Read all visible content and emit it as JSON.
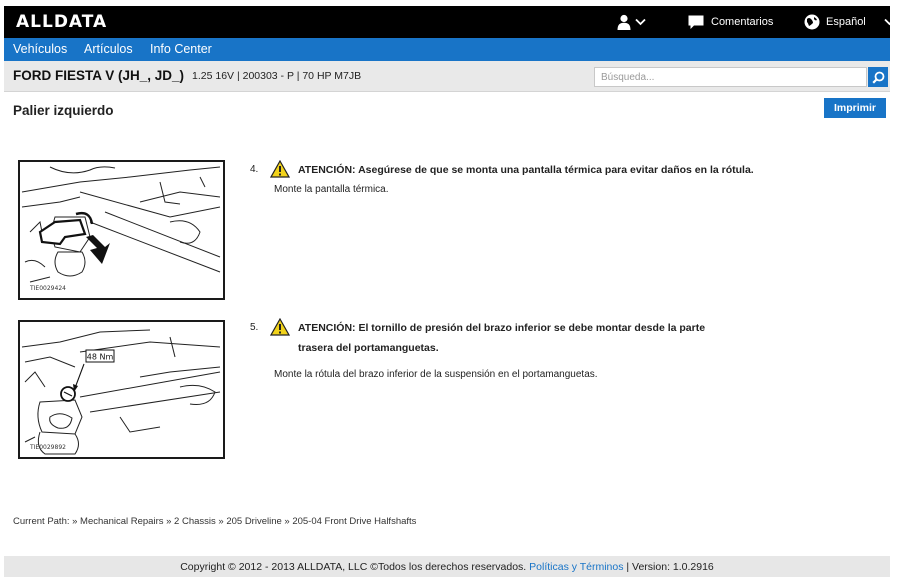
{
  "header": {
    "logo": "ALLDATA",
    "feedback_label": "Comentarios",
    "language_label": "Español"
  },
  "nav": {
    "items": [
      {
        "label": "Vehículos"
      },
      {
        "label": "Artículos"
      },
      {
        "label": "Info Center"
      }
    ]
  },
  "vehicle": {
    "name": "FORD FIESTA V (JH_, JD_)",
    "details": "1.25 16V | 200303 - P | 70 HP M7JB"
  },
  "search": {
    "placeholder": "Búsqueda..."
  },
  "page": {
    "title": "Palier izquierdo",
    "print_label": "Imprimir"
  },
  "steps": [
    {
      "number": "4.",
      "warning_line1": "ATENCIÓN: Asegúrese de que se monta una pantalla térmica para evitar daños en la rótula.",
      "warning_line2": "",
      "instruction": "Monte la pantalla térmica.",
      "figure_code": "TIE0029424"
    },
    {
      "number": "5.",
      "warning_line1": "ATENCIÓN: El tornillo de presión del brazo inferior se debe montar desde la parte",
      "warning_line2": "trasera del portamanguetas.",
      "instruction": "Monte la rótula del brazo inferior de la suspensión en el portamanguetas.",
      "figure_code": "TIE0029892",
      "torque_label": "48 Nm"
    }
  ],
  "breadcrumb": {
    "text": "Current Path: » Mechanical Repairs » 2 Chassis » 205 Driveline » 205-04 Front Drive Halfshafts"
  },
  "footer": {
    "copyright": "Copyright © 2012 - 2013 ALLDATA, LLC ©Todos los derechos reservados. ",
    "policies_link": "Políticas y Términos",
    "version": " | Version: 1.0.2916"
  },
  "colors": {
    "brand_blue": "#1874c7",
    "top_bar": "#000000",
    "warning_yellow": "#f2d31b"
  }
}
